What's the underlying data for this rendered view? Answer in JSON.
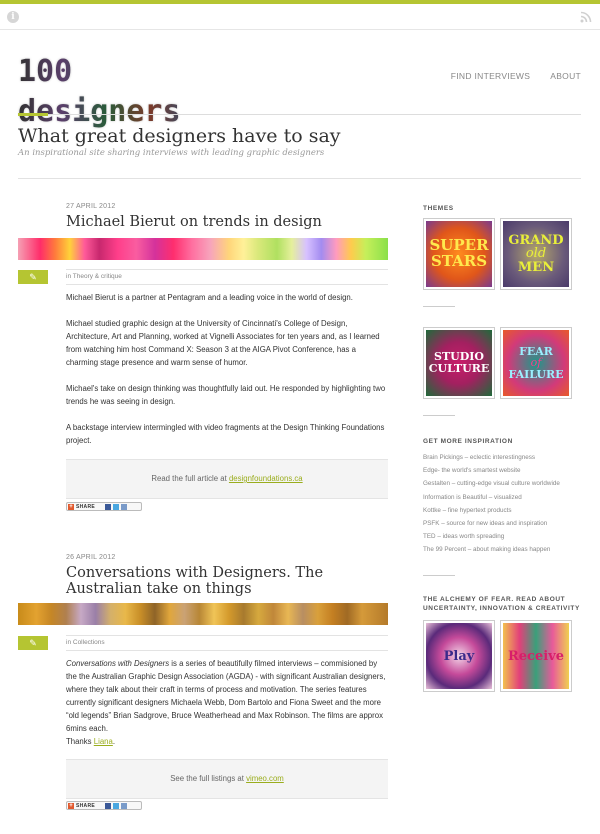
{
  "header": {
    "logo_text": "100 designers",
    "nav": [
      "FIND INTERVIEWS",
      "ABOUT"
    ],
    "site_title": "What great designers have to say",
    "site_subtitle": "An inspirational site sharing interviews with leading graphic designers"
  },
  "colors": {
    "accent": "#b5c532",
    "link": "#9aad1d"
  },
  "icons": {
    "top_left": "info-icon",
    "top_right": "rss-icon",
    "post_format": "pencil-icon"
  },
  "posts": [
    {
      "date": "27 APRIL 2012",
      "title": "Michael Bierut on trends in design",
      "category_prefix": "in ",
      "category": "Theory & critique",
      "paragraphs": [
        "Michael Bierut is a partner at Pentagram and a leading voice in the world of design.",
        "Michael studied graphic design at the University of Cincinnati's College of Design, Architecture, Art and Planning, worked at Vignelli Associates for ten years and, as I learned from watching him host Command X: Season 3 at the AIGA Pivot Conference, has a charming stage presence and warm sense of humor.",
        "Michael's take on design thinking was thoughtfully laid out. He responded by highlighting two trends he was seeing in design.",
        "A backstage interview intermingled with video fragments at the Design Thinking Foundations project."
      ],
      "callout_text": "Read the full article at ",
      "callout_link": "designfoundations.ca",
      "share_label": "SHARE"
    },
    {
      "date": "26 APRIL 2012",
      "title": "Conversations with Designers. The Australian take on things",
      "category_prefix": "in ",
      "category": "Collections",
      "intro_italic": "Conversations with Designers",
      "intro_rest": " is a series of beautifully filmed interviews – commisioned by the the Australian Graphic Design Association (AGDA) - with significant Australian designers, where they talk about their craft in terms of process and motivation. The series features currently significant designers Michaela Webb, Dom Bartolo and Fiona Sweet and the more “old legends” Brian Sadgrove, Bruce Weatherhead and Max Robinson. The films are approx 6mins each.",
      "thanks_text": "Thanks ",
      "thanks_link": "Liana",
      "callout_text": "See the full listings at ",
      "callout_link": "vimeo.com",
      "share_label": "SHARE"
    }
  ],
  "sidebar": {
    "themes_heading": "THEMES",
    "themes": [
      {
        "lines": [
          "SUPER",
          "STARS"
        ]
      },
      {
        "lines": [
          "GRAND",
          "old",
          "MEN"
        ]
      },
      {
        "lines": [
          "STUDIO",
          "CULTURE"
        ]
      },
      {
        "lines": [
          "FEAR",
          "of",
          "FAILURE"
        ]
      }
    ],
    "inspiration_heading": "GET MORE INSPIRATION",
    "links": [
      "Brain Pickings – eclectic interestingness",
      "Edge- the world's smartest website",
      "Gestalten – cutting-edge visual culture worldwide",
      "Information is Beautiful – visualized",
      "Kottke – fine hypertext products",
      "PSFK – source for new ideas and inspiration",
      "TED – ideas worth spreading",
      "The 99 Percent – about making ideas happen"
    ],
    "book_heading": "THE ALCHEMY OF FEAR. READ ABOUT UNCERTAINTY, INNOVATION & CREATIVITY",
    "books": [
      "Play",
      "Receive"
    ]
  }
}
